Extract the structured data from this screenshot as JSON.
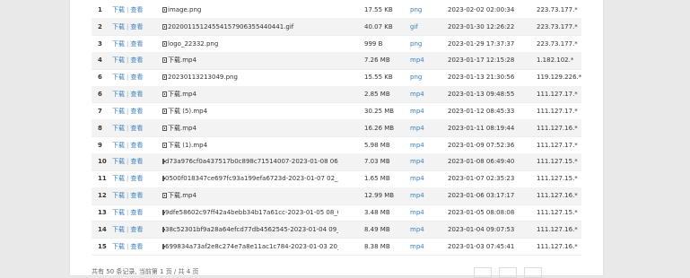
{
  "table": {
    "rows": [
      {
        "no": "1",
        "download": "下载",
        "view": "查看",
        "name": "image.png",
        "size": "17.55 KB",
        "type": "png",
        "date": "2023-02-02 02:00:34",
        "ip": "223.73.177.*"
      },
      {
        "no": "2",
        "download": "下载",
        "view": "查看",
        "name": "20200115124554157906355440441.gif",
        "size": "40.07 KB",
        "type": "gif",
        "date": "2023-01-30 12:26:22",
        "ip": "223.73.177.*"
      },
      {
        "no": "3",
        "download": "下载",
        "view": "查看",
        "name": "logo_22332.png",
        "size": "999 B",
        "type": "png",
        "date": "2023-01-29 17:37:37",
        "ip": "223.73.177.*"
      },
      {
        "no": "4",
        "download": "下载",
        "view": "查看",
        "name": "下载.mp4",
        "size": "7.26 MB",
        "type": "mp4",
        "date": "2023-01-17 12:15:28",
        "ip": "1.182.102.*"
      },
      {
        "no": "6",
        "download": "下载",
        "view": "查看",
        "name": "20230113213049.png",
        "size": "15.55 KB",
        "type": "png",
        "date": "2023-01-13 21:30:56",
        "ip": "119.129.226.*"
      },
      {
        "no": "6",
        "download": "下载",
        "view": "查看",
        "name": "下载.mp4",
        "size": "2.85 MB",
        "type": "mp4",
        "date": "2023-01-13 09:48:55",
        "ip": "111.127.17.*"
      },
      {
        "no": "7",
        "download": "下载",
        "view": "查看",
        "name": "下载 (5).mp4",
        "size": "30.25 MB",
        "type": "mp4",
        "date": "2023-01-12 08:45:33",
        "ip": "111.127.17.*"
      },
      {
        "no": "8",
        "download": "下载",
        "view": "查看",
        "name": "下载.mp4",
        "size": "16.26 MB",
        "type": "mp4",
        "date": "2023-01-11 08:19:44",
        "ip": "111.127.16.*"
      },
      {
        "no": "9",
        "download": "下载",
        "view": "查看",
        "name": "下载 (1).mp4",
        "size": "5.98 MB",
        "type": "mp4",
        "date": "2023-01-09 07:52:36",
        "ip": "111.127.17.*"
      },
      {
        "no": "10",
        "download": "下载",
        "view": "查看",
        "name": "d73a976cf0a437517b0c898c71514007-2023-01-08 06_47_26",
        "size": "7.03 MB",
        "type": "mp4",
        "date": "2023-01-08 06:49:40",
        "ip": "111.127.15.*"
      },
      {
        "no": "11",
        "download": "下载",
        "view": "查看",
        "name": "0500f018347ce697fc93a199efa6723d-2023-01-07 02_34_32...",
        "size": "1.65 MB",
        "type": "mp4",
        "date": "2023-01-07 02:35:23",
        "ip": "111.127.15.*"
      },
      {
        "no": "12",
        "download": "下载",
        "view": "查看",
        "name": "下载.mp4",
        "size": "12.99 MB",
        "type": "mp4",
        "date": "2023-01-06 03:17:17",
        "ip": "111.127.16.*"
      },
      {
        "no": "13",
        "download": "下载",
        "view": "查看",
        "name": "9dfe58602c97ff42a4bebb34b17a61cc-2023-01-05 08_07_36...",
        "size": "3.48 MB",
        "type": "mp4",
        "date": "2023-01-05 08:08:08",
        "ip": "111.127.15.*"
      },
      {
        "no": "14",
        "download": "下载",
        "view": "查看",
        "name": "38c52301bf9a28a64efcd77db4562545-2023-01-04 09_01_49...",
        "size": "8.49 MB",
        "type": "mp4",
        "date": "2023-01-04 09:07:53",
        "ip": "111.127.16.*"
      },
      {
        "no": "15",
        "download": "下载",
        "view": "查看",
        "name": "699834a73af2e8c274e7a8e11ac1c784-2023-01-03 20_12_16...",
        "size": "8.38 MB",
        "type": "mp4",
        "date": "2023-01-03 07:45:41",
        "ip": "111.127.16.*"
      }
    ]
  },
  "footer": {
    "summary": "共有 50 条记录, 当前第 1 页 / 共 4 页"
  }
}
